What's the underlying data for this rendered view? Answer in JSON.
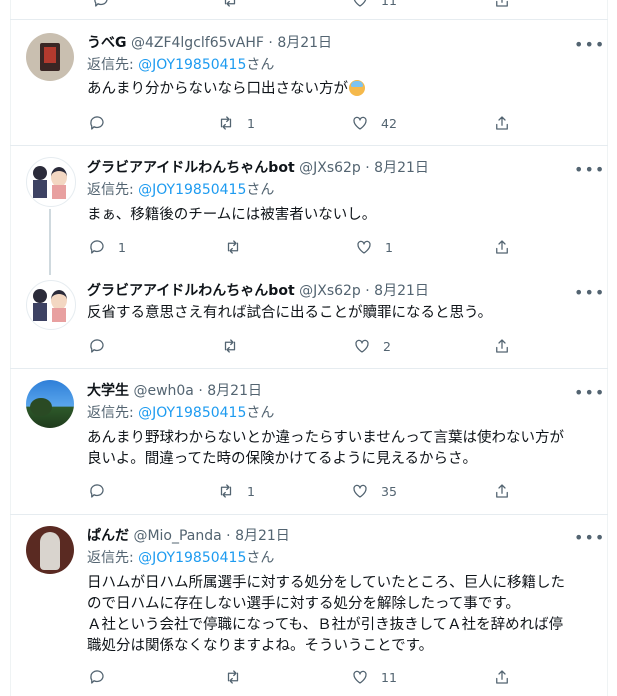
{
  "tweets": [
    {
      "name": "うべG",
      "handle": "@4ZF4lgclf65vAHF",
      "date": "8月21日",
      "reply_prefix": "返信先: ",
      "reply_to": "@JOY19850415",
      "reply_suffix": "さん",
      "text": "あんまり分からないなら口出さない方が",
      "text_emoji": "person-gesturing-no-emoji",
      "counts": {
        "reply": "",
        "retweet": "1",
        "like": "42"
      }
    },
    {
      "name": "グラビアアイドルわんちゃんbot",
      "handle": "@JXs62p",
      "date": "8月21日",
      "reply_prefix": "返信先: ",
      "reply_to": "@JOY19850415",
      "reply_suffix": "さん",
      "text": "まぁ、移籍後のチームには被害者いないし。",
      "counts": {
        "reply": "1",
        "retweet": "",
        "like": "1"
      }
    },
    {
      "name": "グラビアアイドルわんちゃんbot",
      "handle": "@JXs62p",
      "date": "8月21日",
      "text": "反省する意思さえ有れば試合に出ることが贖罪になると思う。",
      "counts": {
        "reply": "",
        "retweet": "",
        "like": "2"
      }
    },
    {
      "name": "大学生",
      "handle": "@ewh0a",
      "date": "8月21日",
      "reply_prefix": "返信先: ",
      "reply_to": "@JOY19850415",
      "reply_suffix": "さん",
      "text": "あんまり野球わからないとか違ったらすいませんって言葉は使わない方が\n良いよ。間違ってた時の保険かけてるように見えるからさ。",
      "counts": {
        "reply": "",
        "retweet": "1",
        "like": "35"
      }
    },
    {
      "name": "ぱんだ",
      "handle": "@Mio_Panda",
      "date": "8月21日",
      "reply_prefix": "返信先: ",
      "reply_to": "@JOY19850415",
      "reply_suffix": "さん",
      "text": "日ハムが日ハム所属選手に対する処分をしていたところ、巨人に移籍した\nので日ハムに存在しない選手に対する処分を解除したって事です。\nＡ社という会社で停職になっても、Ｂ社が引き抜きしてＡ社を辞めれば停\n職処分は関係なくなりますよね。そういうことです。",
      "counts": {
        "reply": "",
        "retweet": "",
        "like": "11"
      }
    }
  ],
  "top_partial": {
    "like": "11"
  },
  "dot": "·",
  "more_icon": "more-icon",
  "colors": {
    "mention": "#1d9bf0",
    "muted": "#536471",
    "text": "#0f1419"
  }
}
